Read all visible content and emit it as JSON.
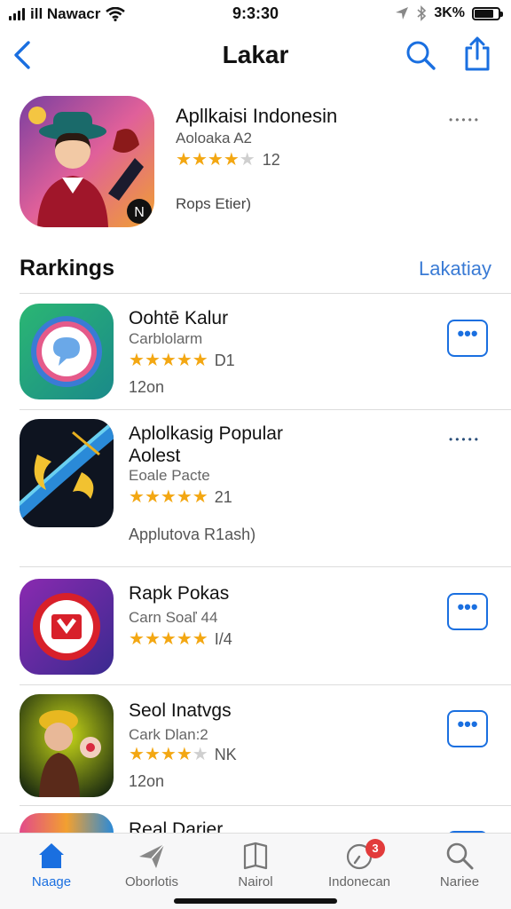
{
  "status_bar": {
    "carrier": "ill Nawacr",
    "time": "9:3:30",
    "battery": "3K%"
  },
  "nav": {
    "title": "Lakar",
    "back_icon": "chevron-left-icon",
    "search_icon": "search-icon",
    "share_icon": "share-icon"
  },
  "featured": {
    "title": "Apllkaisi Indonesin",
    "subtitle": "Aoloaka A2",
    "rating": 3.5,
    "rating_count": "12",
    "meta": "Rops Etier)"
  },
  "section": {
    "title": "Rarkings",
    "link": "Lakatiay"
  },
  "rankings": [
    {
      "title": "Oohtē Kalur",
      "subtitle": "Carblolarm",
      "rating": 4.5,
      "rating_count": "D1",
      "meta": "12on",
      "action": "button"
    },
    {
      "title": "Aplolkasig Popular Aolest",
      "subtitle": "Eoale Pacte",
      "rating": 4.5,
      "rating_count": "21",
      "meta": "Applutova R1ash)",
      "action": "dots"
    },
    {
      "title": "Rapk Pokas",
      "subtitle": "Carn Soaľ 44",
      "rating": 4.5,
      "rating_count": "I/4",
      "meta": "",
      "action": "button"
    },
    {
      "title": "Seol Inatvgs",
      "subtitle": "Cark Dlan:2",
      "rating": 4,
      "rating_count": "NK",
      "meta": "12on",
      "action": "button"
    },
    {
      "title": "Real Darier",
      "subtitle": "",
      "rating": 0,
      "rating_count": "",
      "meta": "",
      "action": "button"
    }
  ],
  "more_label": "•••",
  "dots_label": "•••••",
  "tabs": [
    {
      "label": "Naage",
      "icon": "home-icon",
      "active": true
    },
    {
      "label": "Oborlotis",
      "icon": "paper-plane-icon",
      "active": false
    },
    {
      "label": "Nairol",
      "icon": "book-icon",
      "active": false
    },
    {
      "label": "Indonecan",
      "icon": "clock-icon",
      "active": false,
      "badge": "3"
    },
    {
      "label": "Nariee",
      "icon": "search-icon",
      "active": false
    }
  ],
  "colors": {
    "accent": "#1a6fe0",
    "star": "#f3a712",
    "badge": "#e23b3b"
  }
}
